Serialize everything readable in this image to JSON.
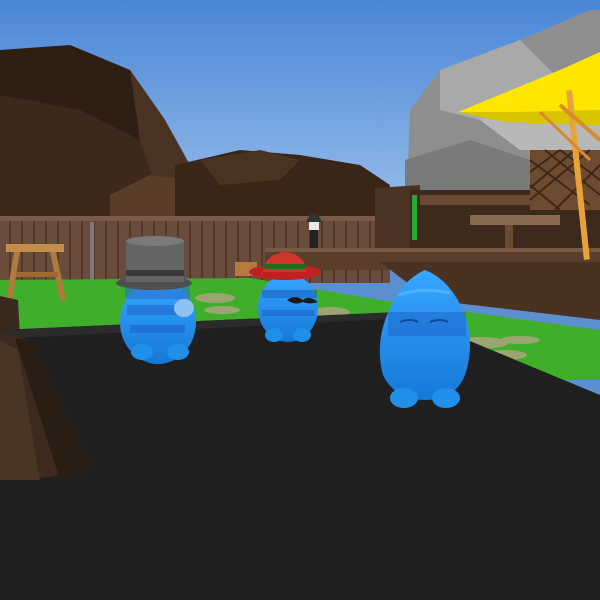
{
  "scene": {
    "kind": "3d-game-viewport",
    "setting": "backyard-patio",
    "colors": {
      "sky_top": "#4a86d6",
      "sky_bottom": "#9cc2ee",
      "grass": "#3fae2a",
      "table_top": "#1f1f1f",
      "table_edge": "#3a2a1c",
      "fence": "#6d5040",
      "umbrella": "#ffe600",
      "character_blue": "#1f8fe8",
      "mountain_gray": "#8f8f8f",
      "rock_brown": "#3b261a"
    },
    "characters": [
      {
        "name": "blue-blob-top-hat",
        "hat": "gray-top-hat"
      },
      {
        "name": "blue-blob-red-hat-mustache",
        "hat": "red-fedora",
        "accessory": "mustache"
      },
      {
        "name": "blue-blob-pointed-head",
        "hat": "none"
      }
    ]
  }
}
